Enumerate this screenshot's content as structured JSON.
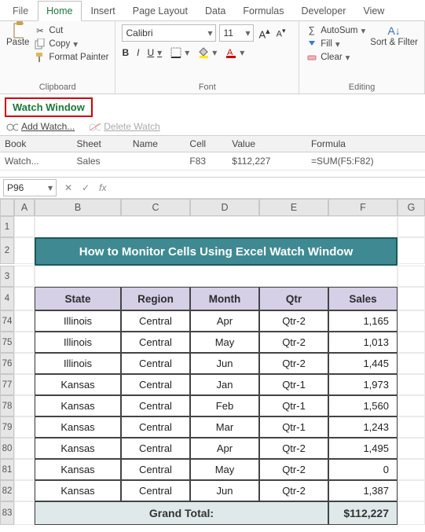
{
  "tabs": {
    "file": "File",
    "home": "Home",
    "insert": "Insert",
    "page_layout": "Page Layout",
    "data": "Data",
    "formulas": "Formulas",
    "developer": "Developer",
    "view": "View"
  },
  "ribbon": {
    "clipboard": {
      "title": "Clipboard",
      "paste": "Paste",
      "cut": "Cut",
      "copy": "Copy",
      "painter": "Format Painter"
    },
    "font": {
      "title": "Font",
      "name": "Calibri",
      "size": "11",
      "bold": "B",
      "italic": "I",
      "underline": "U"
    },
    "editing": {
      "title": "Editing",
      "autosum": "AutoSum",
      "fill": "Fill",
      "clear": "Clear",
      "sort": "Sort & Filter"
    }
  },
  "watch_window": {
    "title": "Watch Window",
    "add": "Add Watch...",
    "delete": "Delete Watch",
    "cols": {
      "book": "Book",
      "sheet": "Sheet",
      "name": "Name",
      "cell": "Cell",
      "value": "Value",
      "formula": "Formula"
    },
    "row": {
      "book": "Watch...",
      "sheet": "Sales",
      "name": "",
      "cell": "F83",
      "value": "$112,227",
      "formula": "=SUM(F5:F82)"
    }
  },
  "namebox": "P96",
  "colheads": [
    "",
    "A",
    "B",
    "C",
    "D",
    "E",
    "F",
    "G"
  ],
  "rownums_top": [
    "1",
    "2",
    "3",
    "4"
  ],
  "content": {
    "banner": "How to Monitor Cells Using Excel Watch Window",
    "headers": [
      "State",
      "Region",
      "Month",
      "Qtr",
      "Sales"
    ],
    "rows": [
      {
        "n": "74",
        "state": "Illinois",
        "region": "Central",
        "month": "Apr",
        "qtr": "Qtr-2",
        "sales": "1,165"
      },
      {
        "n": "75",
        "state": "Illinois",
        "region": "Central",
        "month": "May",
        "qtr": "Qtr-2",
        "sales": "1,013"
      },
      {
        "n": "76",
        "state": "Illinois",
        "region": "Central",
        "month": "Jun",
        "qtr": "Qtr-2",
        "sales": "1,445"
      },
      {
        "n": "77",
        "state": "Kansas",
        "region": "Central",
        "month": "Jan",
        "qtr": "Qtr-1",
        "sales": "1,973"
      },
      {
        "n": "78",
        "state": "Kansas",
        "region": "Central",
        "month": "Feb",
        "qtr": "Qtr-1",
        "sales": "1,560"
      },
      {
        "n": "79",
        "state": "Kansas",
        "region": "Central",
        "month": "Mar",
        "qtr": "Qtr-1",
        "sales": "1,243"
      },
      {
        "n": "80",
        "state": "Kansas",
        "region": "Central",
        "month": "Apr",
        "qtr": "Qtr-2",
        "sales": "1,495"
      },
      {
        "n": "81",
        "state": "Kansas",
        "region": "Central",
        "month": "May",
        "qtr": "Qtr-2",
        "sales": "0"
      },
      {
        "n": "82",
        "state": "Kansas",
        "region": "Central",
        "month": "Jun",
        "qtr": "Qtr-2",
        "sales": "1,387"
      }
    ],
    "total_row_n": "83",
    "grand_total_label": "Grand Total:",
    "grand_total_value": "$112,227"
  },
  "chart_data": {
    "type": "table",
    "title": "How to Monitor Cells Using Excel Watch Window",
    "columns": [
      "State",
      "Region",
      "Month",
      "Qtr",
      "Sales"
    ],
    "rows": [
      [
        "Illinois",
        "Central",
        "Apr",
        "Qtr-2",
        1165
      ],
      [
        "Illinois",
        "Central",
        "May",
        "Qtr-2",
        1013
      ],
      [
        "Illinois",
        "Central",
        "Jun",
        "Qtr-2",
        1445
      ],
      [
        "Kansas",
        "Central",
        "Jan",
        "Qtr-1",
        1973
      ],
      [
        "Kansas",
        "Central",
        "Feb",
        "Qtr-1",
        1560
      ],
      [
        "Kansas",
        "Central",
        "Mar",
        "Qtr-1",
        1243
      ],
      [
        "Kansas",
        "Central",
        "Apr",
        "Qtr-2",
        1495
      ],
      [
        "Kansas",
        "Central",
        "May",
        "Qtr-2",
        0
      ],
      [
        "Kansas",
        "Central",
        "Jun",
        "Qtr-2",
        1387
      ]
    ],
    "grand_total": 112227
  }
}
